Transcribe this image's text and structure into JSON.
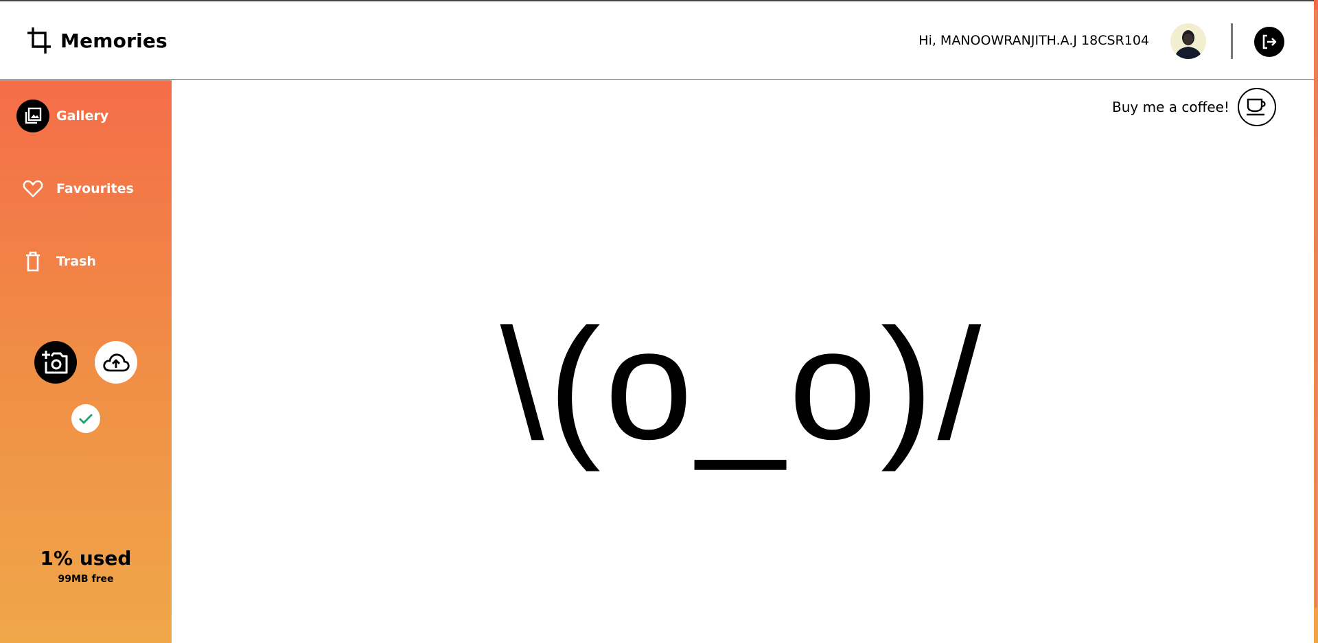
{
  "app": {
    "title": "Memories"
  },
  "header": {
    "greeting": "Hi, MANOOWRANJITH.A.J 18CSR104",
    "avatar_icon": "user-avatar",
    "logout_icon": "logout-icon"
  },
  "sidebar": {
    "items": [
      {
        "label": "Gallery",
        "icon": "gallery-icon",
        "active": true
      },
      {
        "label": "Favourites",
        "icon": "heart-icon",
        "active": false
      },
      {
        "label": "Trash",
        "icon": "trash-icon",
        "active": false
      }
    ],
    "actions": {
      "camera_icon": "add-photo-camera-icon",
      "upload_icon": "cloud-upload-icon",
      "status_icon": "check-icon"
    },
    "storage": {
      "used_label": "1% used",
      "free_label": "99MB free",
      "used_percent": 1
    }
  },
  "main": {
    "coffee_label": "Buy me a coffee!",
    "coffee_icon": "coffee-cup-icon",
    "empty_state": "\\(o_o)/"
  },
  "colors": {
    "sidebar_top": "#f56d48",
    "sidebar_bottom": "#efa748",
    "accent": "#f08d46"
  }
}
